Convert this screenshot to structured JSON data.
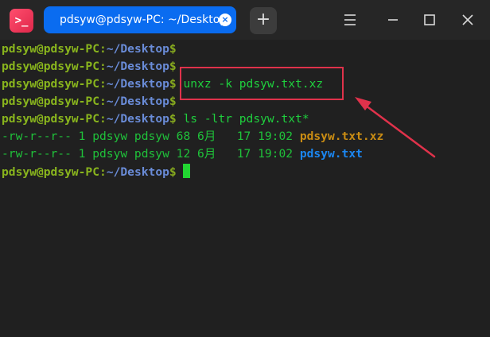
{
  "titlebar": {
    "app_icon_glyph": ">_",
    "tab_title": "pdsyw@pdsyw-PC: ~/Desktop",
    "tab_close_glyph": "×",
    "add_tab_glyph": "+"
  },
  "prompt": {
    "user": "pdsyw@pdsyw-PC",
    "colon": ":",
    "path": "~/Desktop",
    "dollar": "$"
  },
  "commands": {
    "unxz": "unxz -k pdsyw.txt.xz",
    "ls": "ls -ltr pdsyw.txt*"
  },
  "ls_output": [
    {
      "meta": "-rw-r--r-- 1 pdsyw pdsyw 68 6月   17 19:02 ",
      "name": "pdsyw.txt.xz"
    },
    {
      "meta": "-rw-r--r-- 1 pdsyw pdsyw 12 6月   17 19:02 ",
      "name": "pdsyw.txt"
    }
  ],
  "colors": {
    "titlebar": "#262626",
    "tab_active": "#0a6cf0",
    "terminal_bg": "#202020",
    "prompt_user": "#89b51d",
    "prompt_path": "#6a8cd8",
    "command_text": "#1fd03e",
    "archive_file": "#c98c13",
    "text_file": "#1b86f0",
    "annotation": "#e0324b",
    "cursor": "#22d632"
  },
  "icons": [
    "terminal-icon",
    "close-icon",
    "plus-icon",
    "menu-icon",
    "minimize-icon",
    "maximize-icon",
    "close-window-icon",
    "arrow-annotation"
  ]
}
